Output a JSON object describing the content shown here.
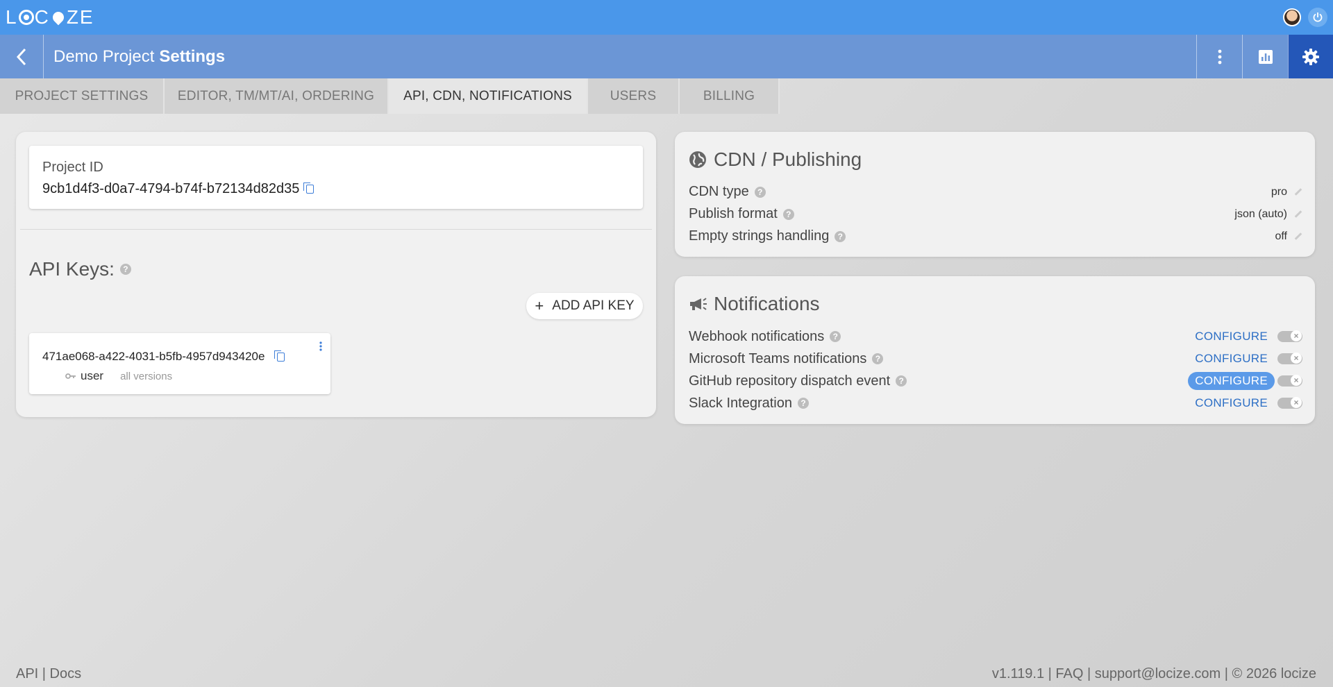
{
  "app": {
    "logo": "LOCIZE"
  },
  "header": {
    "project_name": "Demo Project",
    "page_name": "Settings"
  },
  "tabs": [
    {
      "label": "PROJECT SETTINGS",
      "active": false
    },
    {
      "label": "EDITOR, TM/MT/AI, ORDERING",
      "active": false
    },
    {
      "label": "API, CDN, NOTIFICATIONS",
      "active": true
    },
    {
      "label": "USERS",
      "active": false
    },
    {
      "label": "BILLING",
      "active": false
    }
  ],
  "project": {
    "id_label": "Project ID",
    "id_value": "9cb1d4f3-d0a7-4794-b74f-b72134d82d35"
  },
  "api_keys": {
    "heading": "API Keys:",
    "add_button": "ADD API KEY",
    "keys": [
      {
        "key": "471ae068-a422-4031-b5fb-4957d943420e",
        "role": "user",
        "versions": "all versions"
      }
    ]
  },
  "cdn": {
    "heading": "CDN / Publishing",
    "rows": [
      {
        "label": "CDN type",
        "value": "pro"
      },
      {
        "label": "Publish format",
        "value": "json (auto)"
      },
      {
        "label": "Empty strings handling",
        "value": "off"
      }
    ]
  },
  "notifications": {
    "heading": "Notifications",
    "configure_label": "CONFIGURE",
    "rows": [
      {
        "label": "Webhook notifications",
        "enabled": false
      },
      {
        "label": "Microsoft Teams notifications",
        "enabled": false
      },
      {
        "label": "GitHub repository dispatch event",
        "enabled": false
      },
      {
        "label": "Slack Integration",
        "enabled": false
      }
    ]
  },
  "footer": {
    "left": "API | Docs",
    "right": "v1.119.1 | FAQ | support@locize.com | © 2026 locize"
  },
  "colors": {
    "topbar": "#4a97ea",
    "navbar": "#6b96d6",
    "active_nav": "#2457b8",
    "link": "#2d6fc5"
  }
}
